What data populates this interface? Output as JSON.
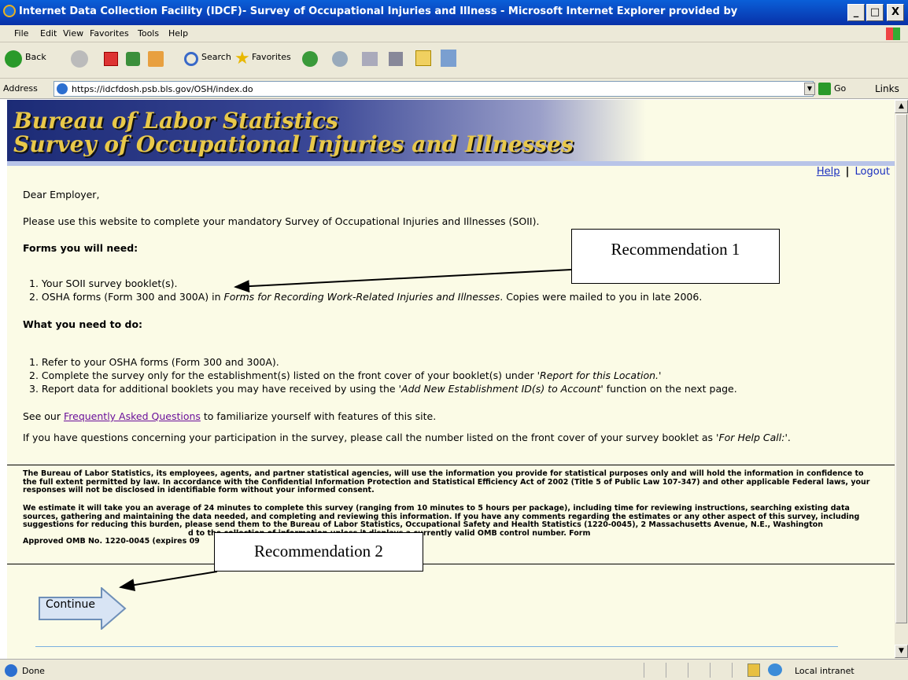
{
  "window": {
    "title": "Internet Data Collection Facility (IDCF)- Survey of Occupational Injuries and Illness - Microsoft Internet Explorer provided by",
    "min": "_",
    "max": "□",
    "close": "X"
  },
  "menu": [
    "File",
    "Edit",
    "View",
    "Favorites",
    "Tools",
    "Help"
  ],
  "toolbar": {
    "back": "Back",
    "search": "Search",
    "favorites": "Favorites"
  },
  "address": {
    "label": "Address",
    "url": "https://idcfdosh.psb.bls.gov/OSH/index.do",
    "go": "Go",
    "links": "Links"
  },
  "banner": {
    "line1": "Bureau of Labor Statistics",
    "line2": "Survey of Occupational Injuries and Illnesses"
  },
  "nav": {
    "help": "Help",
    "sep": "|",
    "logout": "Logout"
  },
  "body": {
    "greeting": "Dear Employer,",
    "intro": "Please use this website to complete your mandatory Survey of Occupational Injuries and Illnesses (SOII).",
    "forms_heading": "Forms you will need:",
    "forms_items": [
      "1.  Your SOII survey booklet(s).",
      "2.  OSHA forms (Form 300 and 300A) in ",
      "Forms for Recording Work-Related Injuries and Illnesses",
      ". Copies were mailed to you in late 2006."
    ],
    "todo_heading": "What you need to do:",
    "todo_items": [
      "1.  Refer to your OSHA forms (Form 300 and 300A).",
      "2.  Complete the survey only for the establishment(s) listed on the front cover of your booklet(s) under ",
      "'Report for this Location.'",
      "3.  Report data for additional booklets you may have received by using the ",
      "'Add New Establishment ID(s) to Account'",
      " function on the next page."
    ],
    "faq_pre": "See our ",
    "faq_link": "Frequently Asked Questions",
    "faq_post": " to familiarize yourself with features of this site.",
    "questions_1": "If you have questions concerning your participation in the survey, please call the number listed on the front cover of your survey booklet as ",
    "questions_2": "'For",
    "questions_3": "Help Call:'",
    "questions_4": "."
  },
  "legal": {
    "p1": "The Bureau of Labor Statistics, its employees, agents, and partner statistical agencies, will use the information you provide for statistical purposes only and will hold the information in confidence to the full extent permitted by law. In accordance with the Confidential Information Protection and Statistical Efficiency Act of 2002 (Title 5 of Public Law 107-347) and other applicable Federal laws, your responses will not be disclosed in identifiable form without your informed consent.",
    "p2a": "We estimate it will take you an average of 24 minutes to complete this survey (ranging from 10 minutes to 5 hours per package), including time for reviewing instructions, searching existing data sources, gathering and maintaining the data needed, and completing and reviewing this information. If you have any comments regarding the estimates or any other aspect of this survey, including suggestions for reducing this burden, please send them to the Bureau of Labor Statistics, Occupational Safety and Health Statistics (1220-0045), 2 Massachusetts Avenue, N.E., Washington",
    "p2b": "d to the collection of information unless it displays a currently valid OMB control number. Form",
    "p2c": "Approved OMB No. 1220-0045 (expires 09"
  },
  "continue_label": "Continue",
  "callouts": {
    "rec1": "Recommendation 1",
    "rec2": "Recommendation 2"
  },
  "status": {
    "text": "Done",
    "zone": "Local intranet"
  }
}
